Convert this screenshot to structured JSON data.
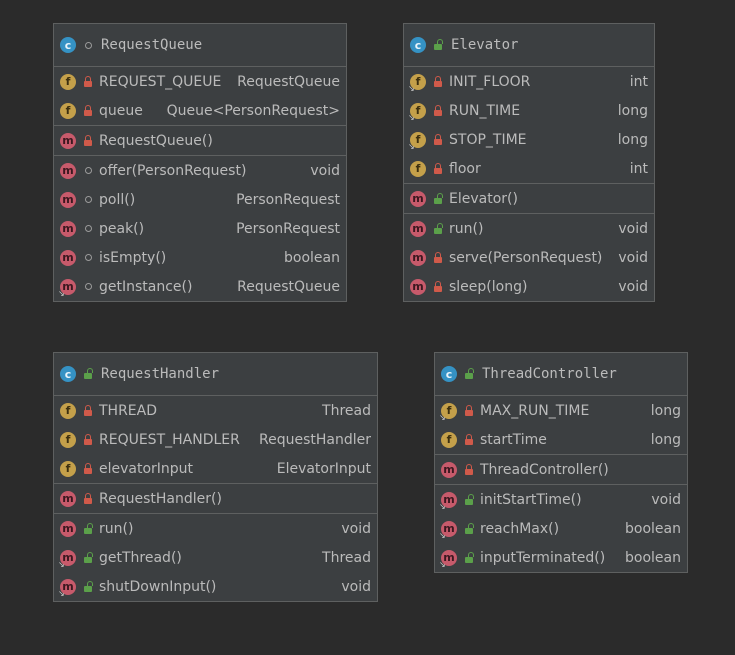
{
  "classes": [
    {
      "name": "RequestQueue",
      "visibility": "package",
      "fields": [
        {
          "name": "REQUEST_QUEUE",
          "type": "RequestQueue",
          "vis": "private",
          "static": false
        },
        {
          "name": "queue",
          "type": "Queue<PersonRequest>",
          "vis": "private",
          "static": false
        }
      ],
      "constructors": [
        {
          "name": "RequestQueue()",
          "type": "",
          "vis": "private",
          "static": false
        }
      ],
      "methods": [
        {
          "name": "offer(PersonRequest)",
          "type": "void",
          "vis": "package",
          "static": false
        },
        {
          "name": "poll()",
          "type": "PersonRequest",
          "vis": "package",
          "static": false
        },
        {
          "name": "peak()",
          "type": "PersonRequest",
          "vis": "package",
          "static": false
        },
        {
          "name": "isEmpty()",
          "type": "boolean",
          "vis": "package",
          "static": false
        },
        {
          "name": "getInstance()",
          "type": "RequestQueue",
          "vis": "package",
          "static": true
        }
      ]
    },
    {
      "name": "Elevator",
      "visibility": "public",
      "fields": [
        {
          "name": "INIT_FLOOR",
          "type": "int",
          "vis": "private",
          "static": true
        },
        {
          "name": "RUN_TIME",
          "type": "long",
          "vis": "private",
          "static": true
        },
        {
          "name": "STOP_TIME",
          "type": "long",
          "vis": "private",
          "static": true
        },
        {
          "name": "floor",
          "type": "int",
          "vis": "private",
          "static": false
        }
      ],
      "constructors": [
        {
          "name": "Elevator()",
          "type": "",
          "vis": "public",
          "static": false
        }
      ],
      "methods": [
        {
          "name": "run()",
          "type": "void",
          "vis": "public",
          "static": false
        },
        {
          "name": "serve(PersonRequest)",
          "type": "void",
          "vis": "private",
          "static": false
        },
        {
          "name": "sleep(long)",
          "type": "void",
          "vis": "private",
          "static": false
        }
      ]
    },
    {
      "name": "RequestHandler",
      "visibility": "public",
      "fields": [
        {
          "name": "THREAD",
          "type": "Thread",
          "vis": "private",
          "static": false
        },
        {
          "name": "REQUEST_HANDLER",
          "type": "RequestHandler",
          "vis": "private",
          "static": false
        },
        {
          "name": "elevatorInput",
          "type": "ElevatorInput",
          "vis": "private",
          "static": false
        }
      ],
      "constructors": [
        {
          "name": "RequestHandler()",
          "type": "",
          "vis": "private",
          "static": false
        }
      ],
      "methods": [
        {
          "name": "run()",
          "type": "void",
          "vis": "public",
          "static": false
        },
        {
          "name": "getThread()",
          "type": "Thread",
          "vis": "public",
          "static": true
        },
        {
          "name": "shutDownInput()",
          "type": "void",
          "vis": "public",
          "static": true
        }
      ]
    },
    {
      "name": "ThreadController",
      "visibility": "public",
      "fields": [
        {
          "name": "MAX_RUN_TIME",
          "type": "long",
          "vis": "private",
          "static": true
        },
        {
          "name": "startTime",
          "type": "long",
          "vis": "private",
          "static": false
        }
      ],
      "constructors": [
        {
          "name": "ThreadController()",
          "type": "",
          "vis": "private",
          "static": false
        }
      ],
      "methods": [
        {
          "name": "initStartTime()",
          "type": "void",
          "vis": "public",
          "static": true
        },
        {
          "name": "reachMax()",
          "type": "boolean",
          "vis": "public",
          "static": true
        },
        {
          "name": "inputTerminated()",
          "type": "boolean",
          "vis": "public",
          "static": true
        }
      ]
    }
  ],
  "icons": {
    "class_letter": "c",
    "field_letter": "f",
    "method_letter": "m"
  },
  "colors": {
    "background": "#2b2b2b",
    "panel": "#3c3f41",
    "class_icon": "#3592c4",
    "field_icon": "#c4a04a",
    "method_icon": "#c75a6b",
    "private": "#d05a4a",
    "public": "#5ba04a"
  }
}
